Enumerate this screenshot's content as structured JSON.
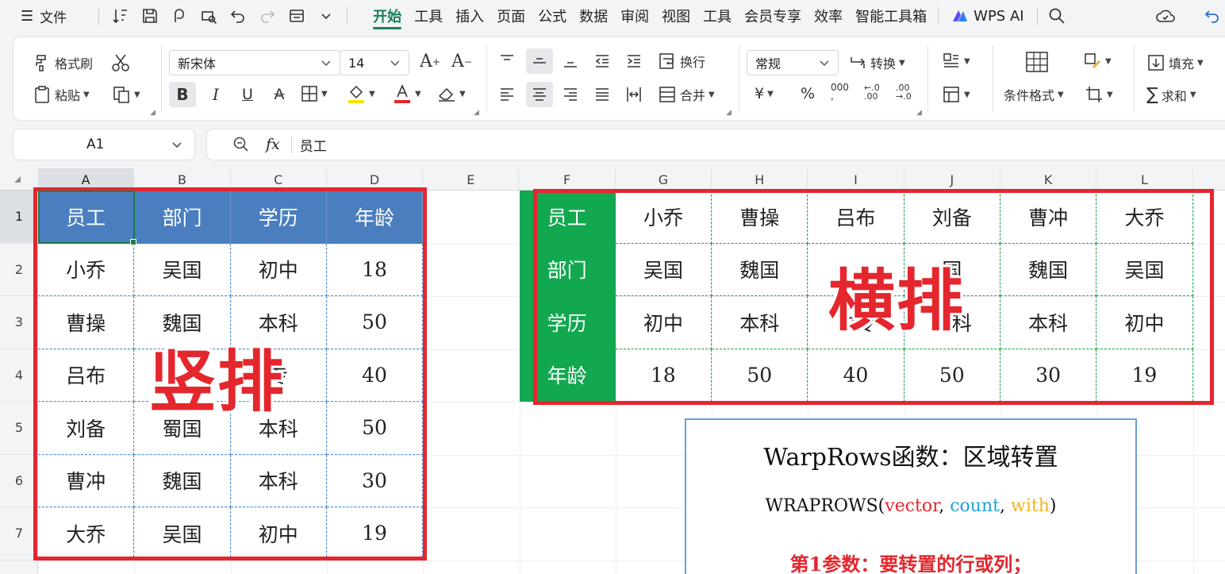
{
  "menubar": {
    "file_label": "文件",
    "tabs": [
      "开始",
      "工具",
      "插入",
      "页面",
      "公式",
      "数据",
      "审阅",
      "视图",
      "工具",
      "会员专享",
      "效率",
      "智能工具箱"
    ],
    "active_tab": "开始",
    "ai_label": "WPS AI"
  },
  "ribbon": {
    "format_painter": "格式刷",
    "paste": "粘贴",
    "font_name": "新宋体",
    "font_size": "14",
    "wrap": "换行",
    "merge": "合并",
    "number_format": "常规",
    "convert": "转换",
    "conditional_format": "条件格式",
    "fill": "填充",
    "sum": "求和"
  },
  "formula": {
    "name_box": "A1",
    "fx": "fx",
    "content": "员工"
  },
  "grid": {
    "columns": [
      "A",
      "B",
      "C",
      "D",
      "E",
      "F",
      "G",
      "H",
      "I",
      "J",
      "K",
      "L"
    ],
    "rows": [
      "1",
      "2",
      "3",
      "4",
      "5",
      "6",
      "7"
    ]
  },
  "vertical_table": [
    [
      "员工",
      "部门",
      "学历",
      "年龄"
    ],
    [
      "小乔",
      "吴国",
      "初中",
      "18"
    ],
    [
      "曹操",
      "魏国",
      "本科",
      "50"
    ],
    [
      "吕布",
      "",
      "专",
      "40"
    ],
    [
      "刘备",
      "蜀国",
      "本科",
      "50"
    ],
    [
      "曹冲",
      "魏国",
      "本科",
      "30"
    ],
    [
      "大乔",
      "吴国",
      "初中",
      "19"
    ]
  ],
  "horizontal_table": [
    [
      "员工",
      "小乔",
      "曹操",
      "吕布",
      "刘备",
      "曹冲",
      "大乔"
    ],
    [
      "部门",
      "吴国",
      "魏国",
      "",
      "国",
      "魏国",
      "吴国"
    ],
    [
      "学历",
      "初中",
      "本科",
      "中专",
      "本科",
      "本科",
      "初中"
    ],
    [
      "年龄",
      "18",
      "50",
      "40",
      "50",
      "30",
      "19"
    ]
  ],
  "overlays": {
    "left": "竖排",
    "right": "横排"
  },
  "info": {
    "title": "WarpRows函数：区域转置",
    "syntax_fn": "WRAPROWS(",
    "arg1": "vector",
    "comma1": ", ",
    "arg2": "count",
    "comma2": ", ",
    "arg3": "with",
    "close": ")",
    "param1": "第1参数：要转置的行或列；"
  },
  "colors": {
    "accent_green": "#1a7f5a",
    "header_blue": "#4a7ebf",
    "header_green": "#12a850",
    "highlight_red": "#e4262d",
    "arg_vector": "#e4262d",
    "arg_count": "#1aa3d6",
    "arg_with": "#f0b323"
  }
}
